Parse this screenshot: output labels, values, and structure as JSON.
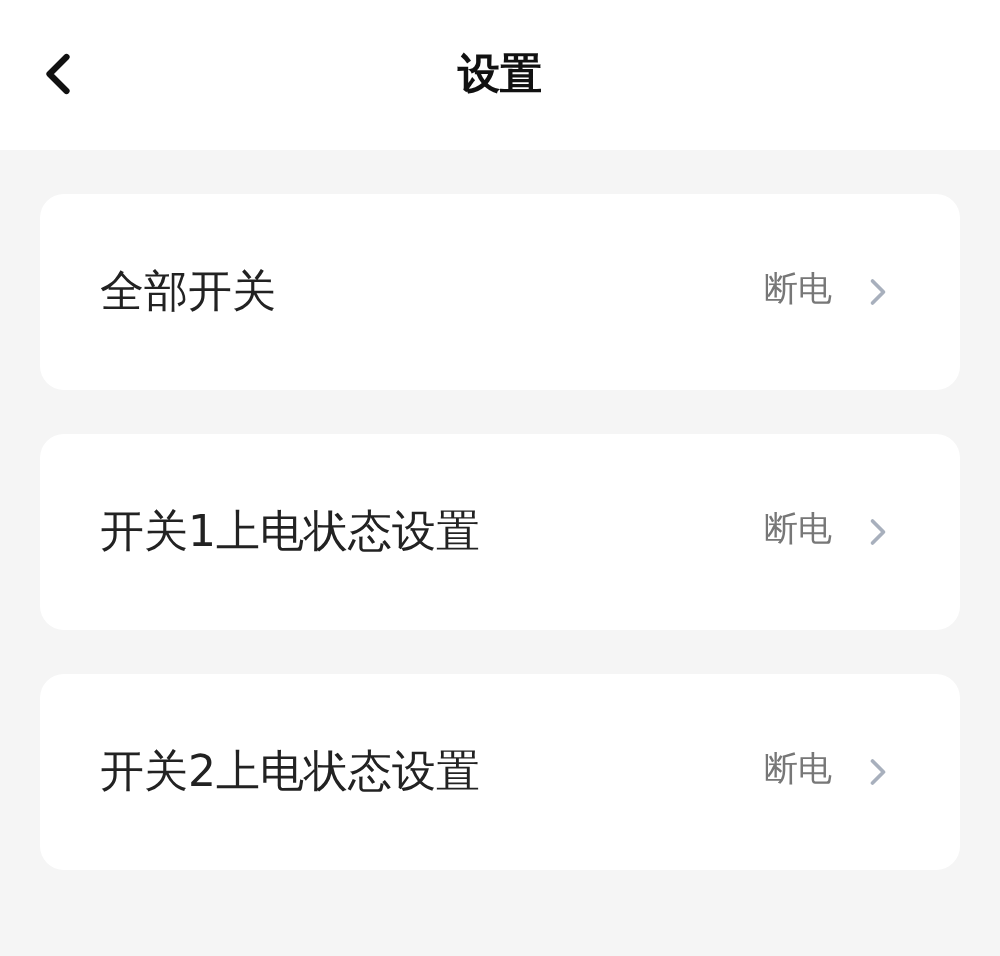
{
  "header": {
    "title": "设置"
  },
  "items": [
    {
      "label": "全部开关",
      "value": "断电"
    },
    {
      "label": "开关1上电状态设置",
      "value": "断电"
    },
    {
      "label": "开关2上电状态设置",
      "value": "断电"
    }
  ]
}
